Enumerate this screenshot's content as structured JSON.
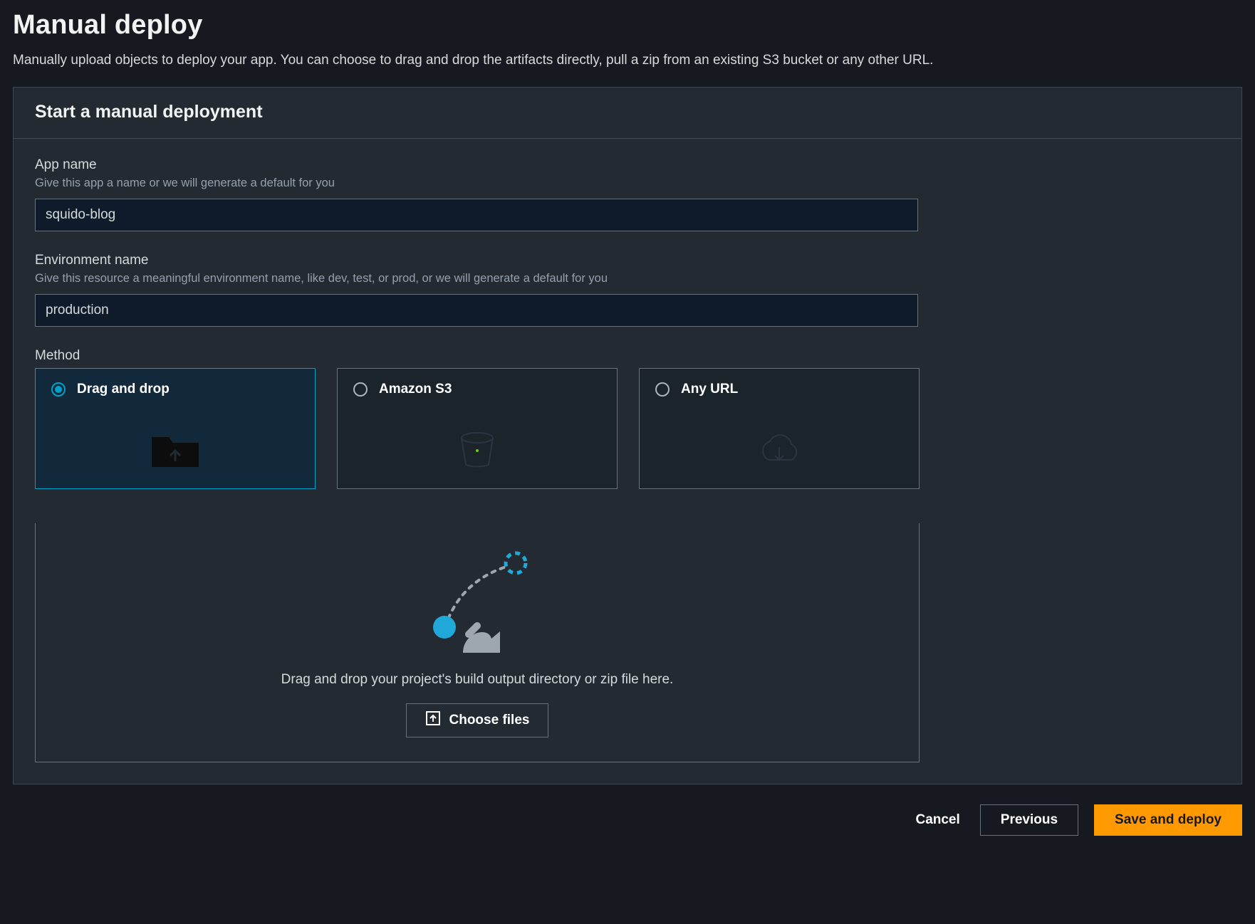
{
  "page": {
    "title": "Manual deploy",
    "description": "Manually upload objects to deploy your app. You can choose to drag and drop the artifacts directly, pull a zip from an existing S3 bucket or any other URL."
  },
  "panel": {
    "header": "Start a manual deployment"
  },
  "fields": {
    "app_name": {
      "label": "App name",
      "hint": "Give this app a name or we will generate a default for you",
      "value": "squido-blog"
    },
    "env_name": {
      "label": "Environment name",
      "hint": "Give this resource a meaningful environment name, like dev, test, or prod, or we will generate a default for you",
      "value": "production"
    },
    "method": {
      "label": "Method",
      "options": [
        {
          "label": "Drag and drop",
          "selected": true
        },
        {
          "label": "Amazon S3",
          "selected": false
        },
        {
          "label": "Any URL",
          "selected": false
        }
      ]
    }
  },
  "dropzone": {
    "message": "Drag and drop your project's build output directory or zip file here.",
    "button": "Choose files"
  },
  "footer": {
    "cancel": "Cancel",
    "previous": "Previous",
    "save": "Save and deploy"
  }
}
